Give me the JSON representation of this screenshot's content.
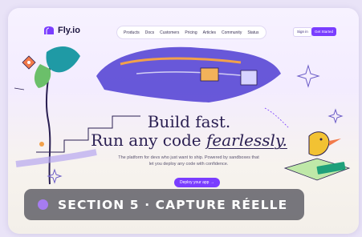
{
  "nav": {
    "logo_text": "Fly.io",
    "items": [
      "Products",
      "Docs",
      "Customers",
      "Pricing",
      "Articles",
      "Community",
      "Status"
    ],
    "sign_in": "Sign in",
    "get_started": "Get Started"
  },
  "hero": {
    "headline_line1": "Build fast.",
    "headline_line2_prefix": "Run any code ",
    "headline_line2_emphasis": "fearlessly.",
    "subtitle": "The platform for devs who just want to ship. Powered by sandboxes that let you deploy any code with confidence.",
    "cta": "Deploy your app →"
  },
  "banner": {
    "text": "SECTION 5 · CAPTURE RÉELLE"
  },
  "colors": {
    "accent": "#7a3dff",
    "heading": "#2a1f52",
    "banner_bg": "#46464f",
    "banner_dot": "#a67cf0"
  },
  "icons": [
    "fly-logo-icon",
    "balloon-illustration",
    "sparkle-icon",
    "bird-character",
    "rocket-icon"
  ]
}
